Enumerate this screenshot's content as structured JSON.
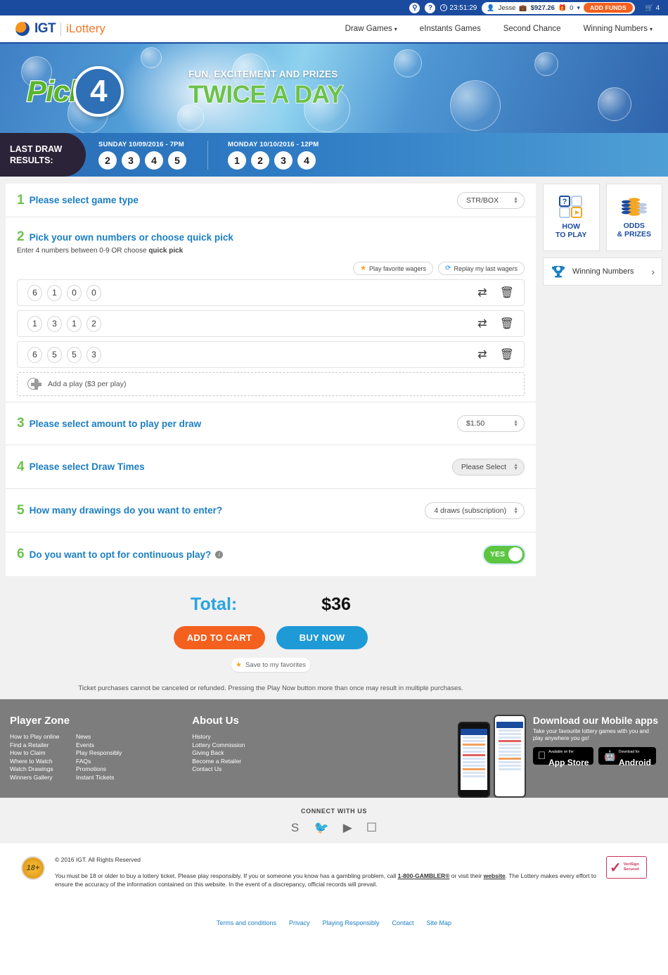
{
  "topbar": {
    "search_icon": "search-icon",
    "help_icon": "help-icon",
    "timer": "23:51:29",
    "user_name": "Jesse",
    "balance": "$927.26",
    "gift_count": "0",
    "add_funds_label": "ADD FUNDS",
    "cart_count": "4"
  },
  "header": {
    "logo_igt": "IGT",
    "logo_ilottery": "iLottery",
    "nav": [
      {
        "label": "Draw Games",
        "caret": true
      },
      {
        "label": "eInstants Games",
        "caret": false
      },
      {
        "label": "Second Chance",
        "caret": false
      },
      {
        "label": "Winning Numbers",
        "caret": true
      }
    ]
  },
  "hero": {
    "pick_word": "Pick",
    "pick_number": "4",
    "line1": "FUN, EXCITEMENT AND PRIZES",
    "line2": "TWICE A DAY"
  },
  "last_draw": {
    "label_line1": "LAST DRAW",
    "label_line2": "RESULTS:",
    "draws": [
      {
        "title": "SUNDAY 10/09/2016 - 7PM",
        "numbers": [
          "2",
          "3",
          "4",
          "5"
        ]
      },
      {
        "title": "MONDAY 10/10/2016 - 12PM",
        "numbers": [
          "1",
          "2",
          "3",
          "4"
        ]
      }
    ]
  },
  "steps": {
    "s1": {
      "num": "1",
      "label": "Please select game type",
      "value": "STR/BOX"
    },
    "s2": {
      "num": "2",
      "label": "Pick your own numbers or choose quick pick",
      "note_pre": "Enter 4 numbers between 0-9 OR choose ",
      "note_bold": "quick pick",
      "fav_btn": "Play favorite wagers",
      "replay_btn": "Replay my last wagers",
      "plays": [
        [
          "6",
          "1",
          "0",
          "0"
        ],
        [
          "1",
          "3",
          "1",
          "2"
        ],
        [
          "6",
          "5",
          "5",
          "3"
        ]
      ],
      "add_play": "Add a play ($3 per play)"
    },
    "s3": {
      "num": "3",
      "label": "Please select amount to play per draw",
      "value": "$1.50"
    },
    "s4": {
      "num": "4",
      "label": "Please select Draw Times",
      "value": "Please Select"
    },
    "s5": {
      "num": "5",
      "label": "How many drawings do you want to enter?",
      "value": "4 draws (subscription)"
    },
    "s6": {
      "num": "6",
      "label": "Do you want to opt for continuous play?",
      "toggle": "YES"
    }
  },
  "total": {
    "label": "Total:",
    "value": "$36",
    "add_to_cart": "ADD TO CART",
    "buy_now": "BUY NOW",
    "save_fav": "Save to my favorites",
    "disclaimer": "Ticket purchases cannot be canceled or refunded. Pressing the Play Now button more than once may result in multiple purchases."
  },
  "sidebar": {
    "how_to_play_l1": "HOW",
    "how_to_play_l2": "TO PLAY",
    "odds_l1": "ODDS",
    "odds_l2": "& PRIZES",
    "winning_numbers": "Winning Numbers"
  },
  "footer": {
    "player_zone_title": "Player Zone",
    "player_zone_col1": [
      "How to Play online",
      "Find a Retailer",
      "How to Claim",
      "Where to Watch",
      "Watch Drawings",
      "Winners Gallery"
    ],
    "player_zone_col2": [
      "News",
      "Events",
      "Play Responsibly",
      "FAQs",
      "Promotions",
      "Instant Tickets"
    ],
    "about_title": "About Us",
    "about_links": [
      "History",
      "Lottery Commission",
      "Giving Back",
      "Become a Retailer",
      "Contact Us"
    ],
    "apps_title": "Download our Mobile apps",
    "apps_sub": "Take your favourite lottery games with you and play anywhere you go!",
    "appstore_small": "Available on the",
    "appstore_big": "App Store",
    "android_small": "Download for",
    "android_big": "Android"
  },
  "connect": {
    "title": "CONNECT WITH US",
    "icons": [
      "facebook-icon",
      "twitter-icon",
      "youtube-icon",
      "instagram-icon"
    ]
  },
  "legal": {
    "badge_18": "18+",
    "copyright": "© 2016 IGT. All Rights Reserved",
    "text_a": "You must be 18 or older to buy a lottery ticket. Please play responsibly. If you or someone you know has a gambling problem, call ",
    "gambler_link": "1-800-GAMBLER®",
    "text_b": " or visit their ",
    "website_link": "website",
    "text_c": ". The Lottery makes every effort to ensure the accuracy of the information contained on this website. In the event of a discrepancy, official records will prevail.",
    "verisign_l1": "VeriSign",
    "verisign_l2": "Secured",
    "bottom_links": [
      "Terms and conditions",
      "Privacy",
      "Playing Responsibly",
      "Contact",
      "Site Map"
    ]
  },
  "colors": {
    "brand_blue": "#1b4b9e",
    "accent_orange": "#f4601e",
    "green": "#6cc24a",
    "link_blue": "#1b7fc4"
  }
}
